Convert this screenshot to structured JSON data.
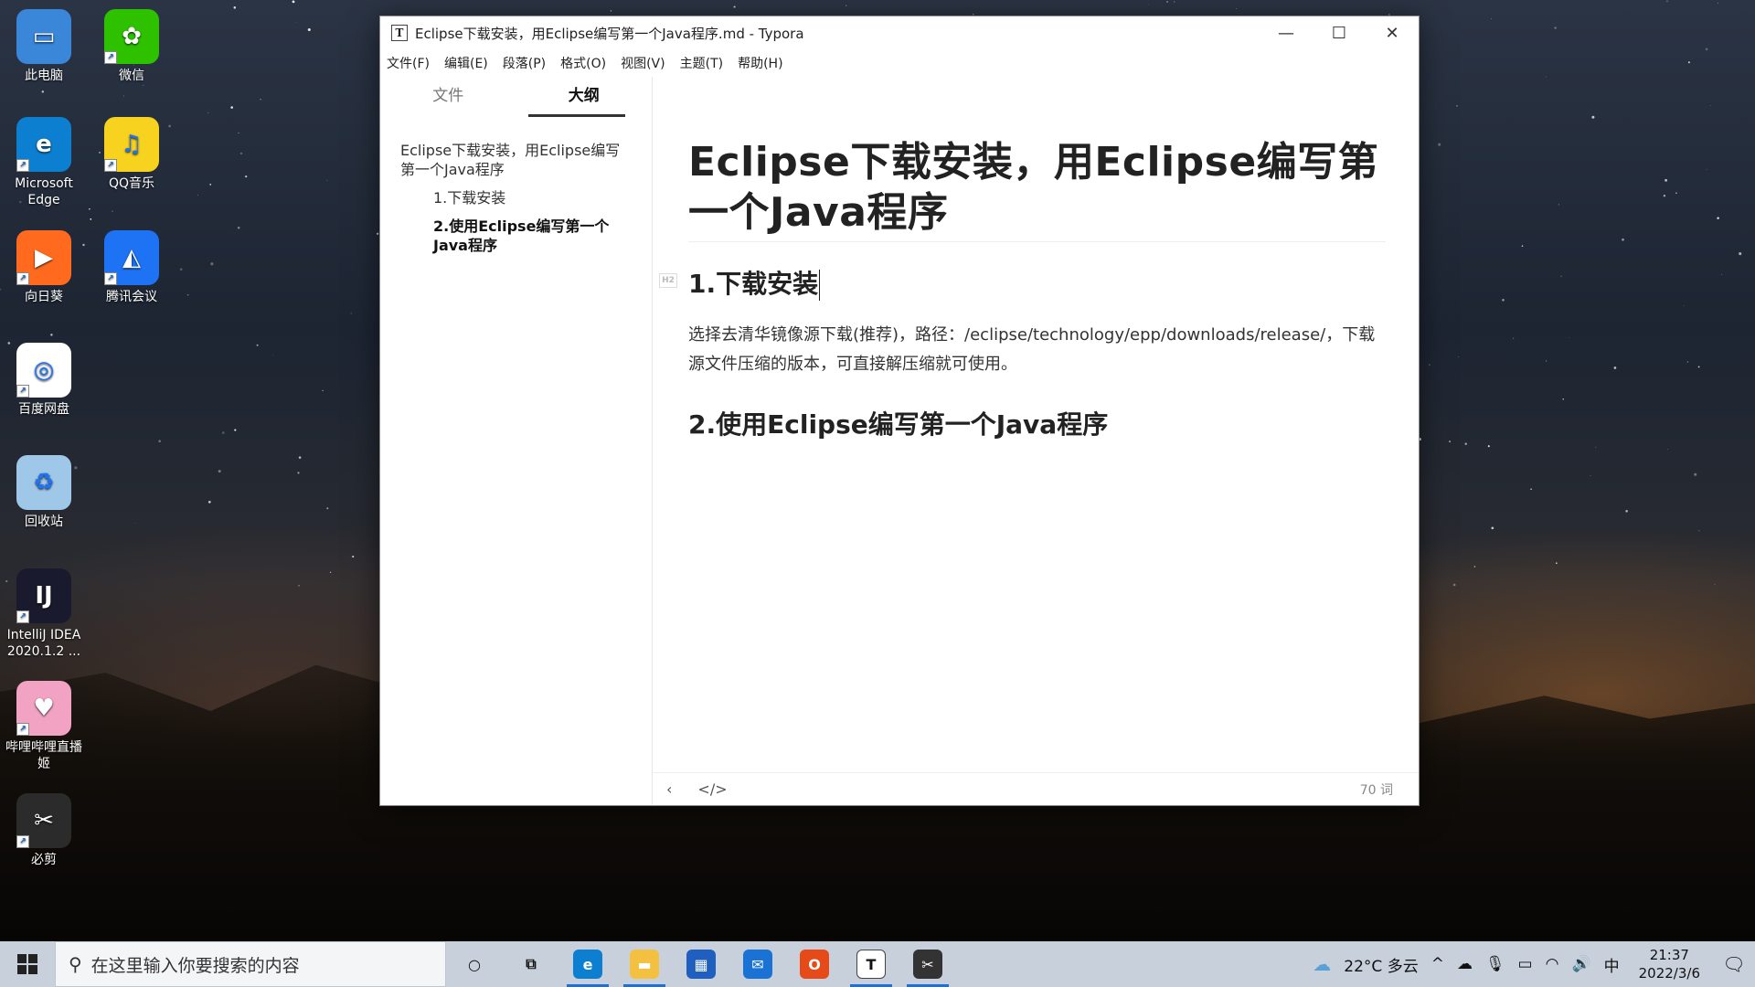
{
  "desktop": {
    "icons": [
      {
        "label": "此电脑",
        "icon": "computer-icon",
        "color": "#3a86d8"
      },
      {
        "label": "微信",
        "icon": "wechat-icon",
        "color": "#2dc100"
      },
      {
        "label": "Microsoft Edge",
        "icon": "edge-icon",
        "color": "#0c7fd0"
      },
      {
        "label": "QQ音乐",
        "icon": "qq-music-icon",
        "color": "#f7d21e"
      },
      {
        "label": "向日葵",
        "icon": "sunflower-icon",
        "color": "#ff6a1f"
      },
      {
        "label": "腾讯会议",
        "icon": "tencent-meeting-icon",
        "color": "#1e73f5"
      },
      {
        "label": "百度网盘",
        "icon": "baidu-netdisk-icon",
        "color": "#ffffff"
      },
      {
        "label": "回收站",
        "icon": "recycle-bin-icon",
        "color": "#9fc8e8"
      },
      {
        "label": "IntelliJ IDEA 2020.1.2 ...",
        "icon": "intellij-icon",
        "color": "#1a1a2e"
      },
      {
        "label": "哔哩哔哩直播姬",
        "icon": "bilibili-live-icon",
        "color": "#f2a3c4"
      },
      {
        "label": "必剪",
        "icon": "bijian-icon",
        "color": "#2b2b2b"
      }
    ]
  },
  "window": {
    "title": "Eclipse下载安装，用Eclipse编写第一个Java程序.md - Typora",
    "app_icon_letter": "T",
    "controls": {
      "minimize": "—",
      "maximize": "☐",
      "close": "✕"
    },
    "menu": [
      "文件(F)",
      "编辑(E)",
      "段落(P)",
      "格式(O)",
      "视图(V)",
      "主题(T)",
      "帮助(H)"
    ]
  },
  "sidebar": {
    "tabs": [
      "文件",
      "大纲"
    ],
    "active_tab": "大纲",
    "outline": [
      {
        "label": "Eclipse下载安装，用Eclipse编写第一个Java程序",
        "level": 1
      },
      {
        "label": "1.下载安装",
        "level": 2
      },
      {
        "label": "2.使用Eclipse编写第一个Java程序",
        "level": 2,
        "current": true
      }
    ]
  },
  "document": {
    "h1": "Eclipse下载安装，用Eclipse编写第一个Java程序",
    "h2_1": "1.下载安装",
    "paragraph": "选择去清华镜像源下载(推荐)，路径：/eclipse/technology/epp/downloads/release/，下载源文件压缩的版本，可直接解压缩就可使用。",
    "h2_2": "2.使用Eclipse编写第一个Java程序"
  },
  "statusbar": {
    "back_label": "‹",
    "source_label": "</>",
    "word_count": "70 词"
  },
  "taskbar": {
    "search_placeholder": "在这里输入你要搜索的内容",
    "apps": [
      {
        "name": "cortana",
        "glyph": "○",
        "color": "transparent"
      },
      {
        "name": "task-view",
        "glyph": "⧉",
        "color": "transparent"
      },
      {
        "name": "edge",
        "glyph": "e",
        "color": "#0c7fd0"
      },
      {
        "name": "file-explorer",
        "glyph": "▬",
        "color": "#f3c040"
      },
      {
        "name": "store",
        "glyph": "▦",
        "color": "#1f5fbf"
      },
      {
        "name": "mail",
        "glyph": "✉",
        "color": "#1a73d4"
      },
      {
        "name": "office",
        "glyph": "O",
        "color": "#e64a19"
      },
      {
        "name": "typora",
        "glyph": "T",
        "color": "#ffffff"
      },
      {
        "name": "bijian",
        "glyph": "✂",
        "color": "#333333"
      }
    ],
    "weather": "22°C 多云",
    "ime": "中",
    "time": "21:37",
    "date": "2022/3/6"
  }
}
